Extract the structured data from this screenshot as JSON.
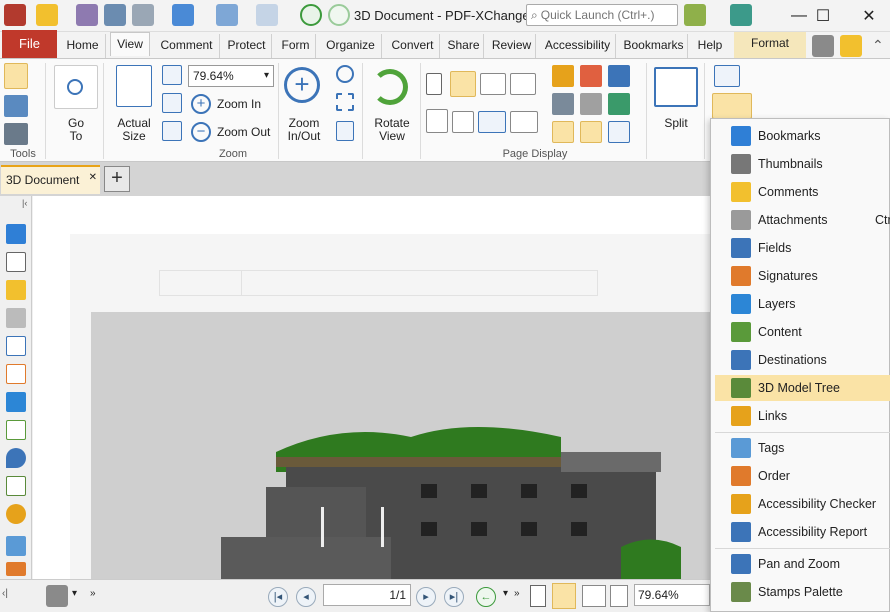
{
  "window": {
    "title": "3D Document - PDF-XChange ..",
    "search_placeholder": "Quick Launch (Ctrl+.)",
    "controls": [
      "—",
      "☐",
      "✕"
    ]
  },
  "ribbon_tabs": [
    "File",
    "Home",
    "View",
    "Comment",
    "Protect",
    "Form",
    "Organize",
    "Convert",
    "Share",
    "Review",
    "Accessibility",
    "Bookmarks",
    "Help",
    "Format"
  ],
  "ribbon": {
    "go_to": "Go\nTo",
    "actual_size": "Actual\nSize",
    "zoom_value": "79.64%",
    "zoom_in": "Zoom In",
    "zoom_out": "Zoom Out",
    "zoom_inout": "Zoom\nIn/Out",
    "rotate_view": "Rotate\nView",
    "split": "Split",
    "groups": {
      "tools": "Tools",
      "zoom": "Zoom",
      "page_display": "Page Display"
    }
  },
  "document_tab": {
    "title": "3D Document",
    "close": "✕",
    "new_tab": "+"
  },
  "statusbar": {
    "page": "1/1",
    "zoom": "79.64%"
  },
  "menu": {
    "items": [
      {
        "label": "Bookmarks",
        "icon": "bookmark-icon",
        "color": "#2f7fd6"
      },
      {
        "label": "Thumbnails",
        "icon": "thumbnails-icon",
        "color": "#777777"
      },
      {
        "label": "Comments",
        "icon": "comment-icon",
        "color": "#f2c02e"
      },
      {
        "label": "Attachments",
        "icon": "paperclip-icon",
        "color": "#9a9a9a"
      },
      {
        "label": "Fields",
        "icon": "fields-icon",
        "color": "#3c74b8"
      },
      {
        "label": "Signatures",
        "icon": "signature-icon",
        "color": "#e07a2c"
      },
      {
        "label": "Layers",
        "icon": "layers-icon",
        "color": "#2c86d6"
      },
      {
        "label": "Content",
        "icon": "content-icon",
        "color": "#5a9a3a"
      },
      {
        "label": "Destinations",
        "icon": "destination-pin-icon",
        "color": "#3c74b8"
      },
      {
        "label": "3D Model Tree",
        "icon": "model-tree-icon",
        "color": "#5a8a3a"
      },
      {
        "label": "Links",
        "icon": "link-icon",
        "color": "#e6a21b"
      },
      {
        "label": "Tags",
        "icon": "tag-icon",
        "color": "#5a9ad6"
      },
      {
        "label": "Order",
        "icon": "order-icon",
        "color": "#e07a2c"
      },
      {
        "label": "Accessibility Checker",
        "icon": "accessibility-checker-icon",
        "color": "#e6a21b"
      },
      {
        "label": "Accessibility Report",
        "icon": "accessibility-report-icon",
        "color": "#3c74b8"
      },
      {
        "label": "Pan and Zoom",
        "icon": "pan-zoom-icon",
        "color": "#3c74b8"
      },
      {
        "label": "Stamps Palette",
        "icon": "stamp-icon",
        "color": "#6a8a4a"
      }
    ],
    "attachments_shortcut": "Ctr",
    "highlight_color": "#fae3a6"
  }
}
